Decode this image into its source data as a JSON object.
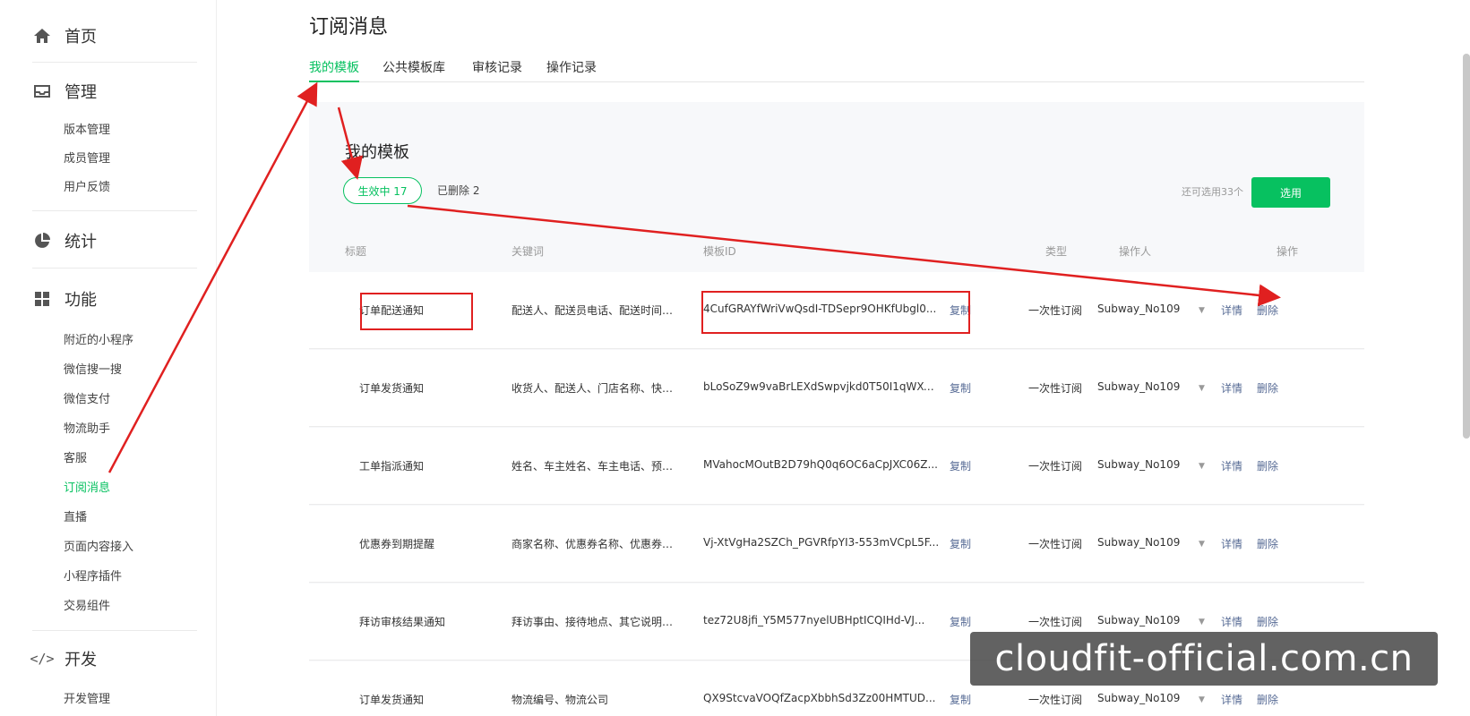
{
  "sidebar": {
    "home": "首页",
    "manage": {
      "label": "管理",
      "items": [
        "版本管理",
        "成员管理",
        "用户反馈"
      ]
    },
    "stats": "统计",
    "features": {
      "label": "功能",
      "items": [
        "附近的小程序",
        "微信搜一搜",
        "微信支付",
        "物流助手",
        "客服",
        "订阅消息",
        "直播",
        "页面内容接入",
        "小程序插件",
        "交易组件"
      ],
      "active": "订阅消息"
    },
    "dev": {
      "label": "开发",
      "items": [
        "开发管理"
      ]
    }
  },
  "header": {
    "title": "订阅消息",
    "tabs": [
      "我的模板",
      "公共模板库",
      "审核记录",
      "操作记录"
    ],
    "active_tab": "我的模板"
  },
  "card": {
    "title": "我的模板",
    "filter_active": "生效中  17",
    "filter_deleted": "已删除  2",
    "quota": "还可选用33个",
    "select_button": "选用"
  },
  "table": {
    "headers": [
      "标题",
      "关键词",
      "模板ID",
      "类型",
      "操作人",
      "操作"
    ],
    "copy_label": "复制",
    "detail_label": "详情",
    "delete_label": "删除",
    "rows": [
      {
        "title": "订单配送通知",
        "keywords": "配送人、配送员电话、配送时间、...",
        "id": "4CufGRAYfWriVwQsdI-TDSepr9OHKfUbgl0...",
        "type": "一次性订阅",
        "operator": "Subway_No109"
      },
      {
        "title": "订单发货通知",
        "keywords": "收货人、配送人、门店名称、快递...",
        "id": "bLoSoZ9w9vaBrLEXdSwpvjkd0T50I1qWXC...",
        "type": "一次性订阅",
        "operator": "Subway_No109"
      },
      {
        "title": "工单指派通知",
        "keywords": "姓名、车主姓名、车主电话、预计...",
        "id": "MVahocMOutB2D79hQ0q6OC6aCpJXC06Z...",
        "type": "一次性订阅",
        "operator": "Subway_No109"
      },
      {
        "title": "优惠券到期提醒",
        "keywords": "商家名称、优惠券名称、优惠券类...",
        "id": "Vj-XtVgHa2SZCh_PGVRfpYI3-553mVCpL5F...",
        "type": "一次性订阅",
        "operator": "Subway_No109"
      },
      {
        "title": "拜访审核结果通知",
        "keywords": "拜访事由、接待地点、其它说明、...",
        "id": "tez72U8jfi_Y5M577nyelUBHptICQIHd-VJ...",
        "type": "一次性订阅",
        "operator": "Subway_No109"
      },
      {
        "title": "订单发货通知",
        "keywords": "物流编号、物流公司",
        "id": "QX9StcvaVOQfZacpXbbhSd3Zz00HMTUD...",
        "type": "一次性订阅",
        "operator": "Subway_No109"
      }
    ]
  },
  "watermark": "cloudfit-official.com.cn",
  "colors": {
    "accent": "#07c160",
    "link": "#576b95",
    "annotation": "#e02020"
  }
}
